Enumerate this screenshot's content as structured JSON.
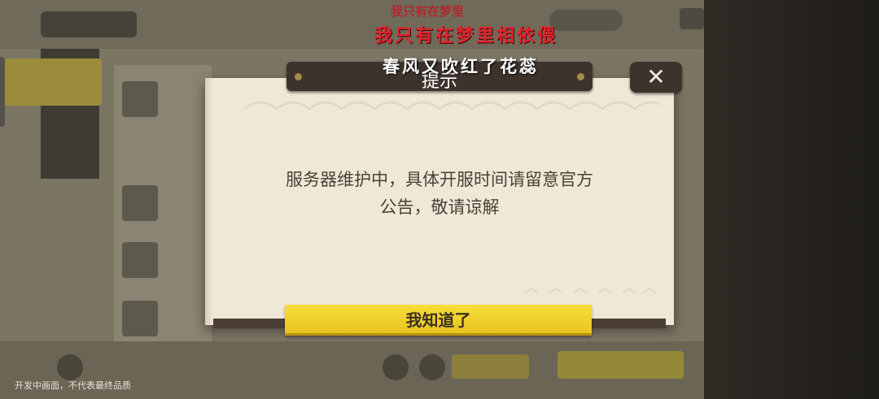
{
  "background": {
    "watermark": "开发中画面，不代表最终品质"
  },
  "overlay_lyrics": {
    "line_top": "我只有在梦里",
    "line_red": "我只有在梦里相依偎",
    "line_white": "春风又吹红了花蕊"
  },
  "dialog": {
    "title": "提示",
    "message_line1": "服务器维护中，具体开服时间请留意官方",
    "message_line2": "公告，敬请谅解",
    "confirm_label": "我知道了",
    "close_icon": "close-icon"
  },
  "colors": {
    "dialog_paper": "#efe8d6",
    "plate_brown": "#3e332c",
    "confirm_yellow": "#f0d12e",
    "lyric_red": "#e0262c"
  }
}
